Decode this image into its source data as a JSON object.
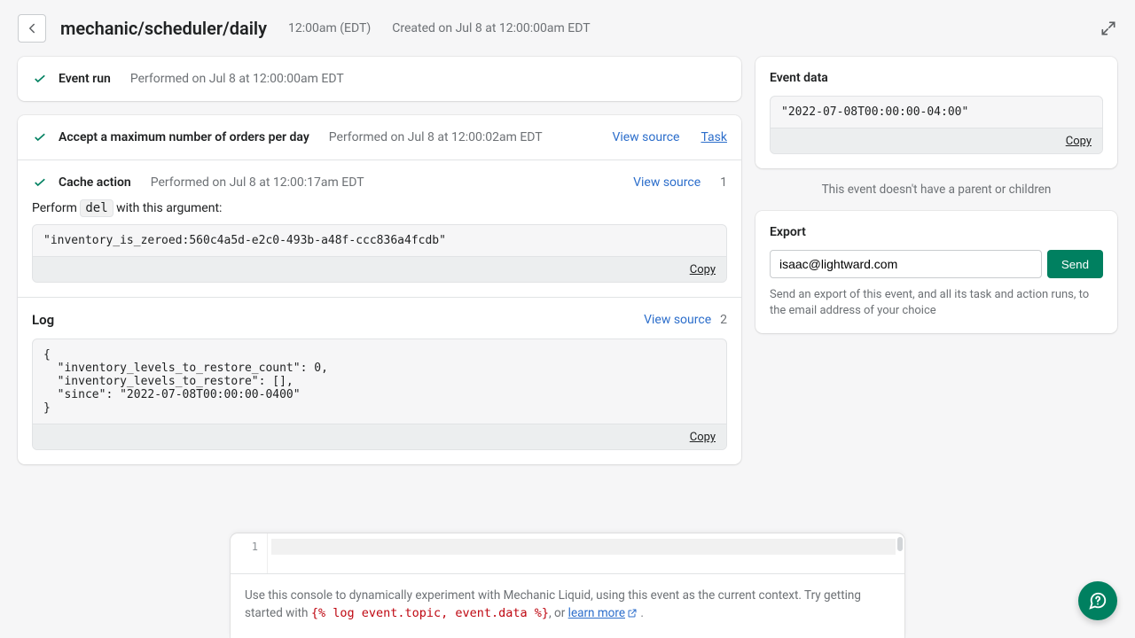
{
  "header": {
    "title": "mechanic/scheduler/daily",
    "time": "12:00am (EDT)",
    "created": "Created on Jul 8 at 12:00:00am EDT"
  },
  "event_run": {
    "title": "Event run",
    "meta": "Performed on Jul 8 at 12:00:00am EDT"
  },
  "task_row": {
    "title": "Accept a maximum number of orders per day",
    "meta": "Performed on Jul 8 at 12:00:02am EDT",
    "view_source": "View source",
    "task_link": "Task"
  },
  "cache_row": {
    "title": "Cache action",
    "meta": "Performed on Jul 8 at 12:00:17am EDT",
    "view_source": "View source",
    "count": "1",
    "perform_prefix": "Perform ",
    "perform_code": "del",
    "perform_suffix": " with this argument:",
    "argument": "\"inventory_is_zeroed:560c4a5d-e2c0-493b-a48f-ccc836a4fcdb\"",
    "copy": "Copy"
  },
  "log": {
    "title": "Log",
    "view_source": "View source",
    "count": "2",
    "body": "{\n  \"inventory_levels_to_restore_count\": 0,\n  \"inventory_levels_to_restore\": [],\n  \"since\": \"2022-07-08T00:00:00-0400\"\n}",
    "copy": "Copy"
  },
  "event_data": {
    "title": "Event data",
    "value": "\"2022-07-08T00:00:00-04:00\"",
    "copy": "Copy",
    "noparent": "This event doesn't have a parent or children"
  },
  "export": {
    "title": "Export",
    "email": "isaac@lightward.com",
    "send": "Send",
    "help": "Send an export of this event, and all its task and action runs, to the email address of your choice"
  },
  "console": {
    "line_no": "1",
    "help_a": "Use this console to dynamically experiment with Mechanic Liquid, using this event as the current context. Try getting started with ",
    "snippet": "{% log event.topic, event.data %}",
    "help_b": ", or ",
    "learn": "learn more",
    "period": " ."
  }
}
